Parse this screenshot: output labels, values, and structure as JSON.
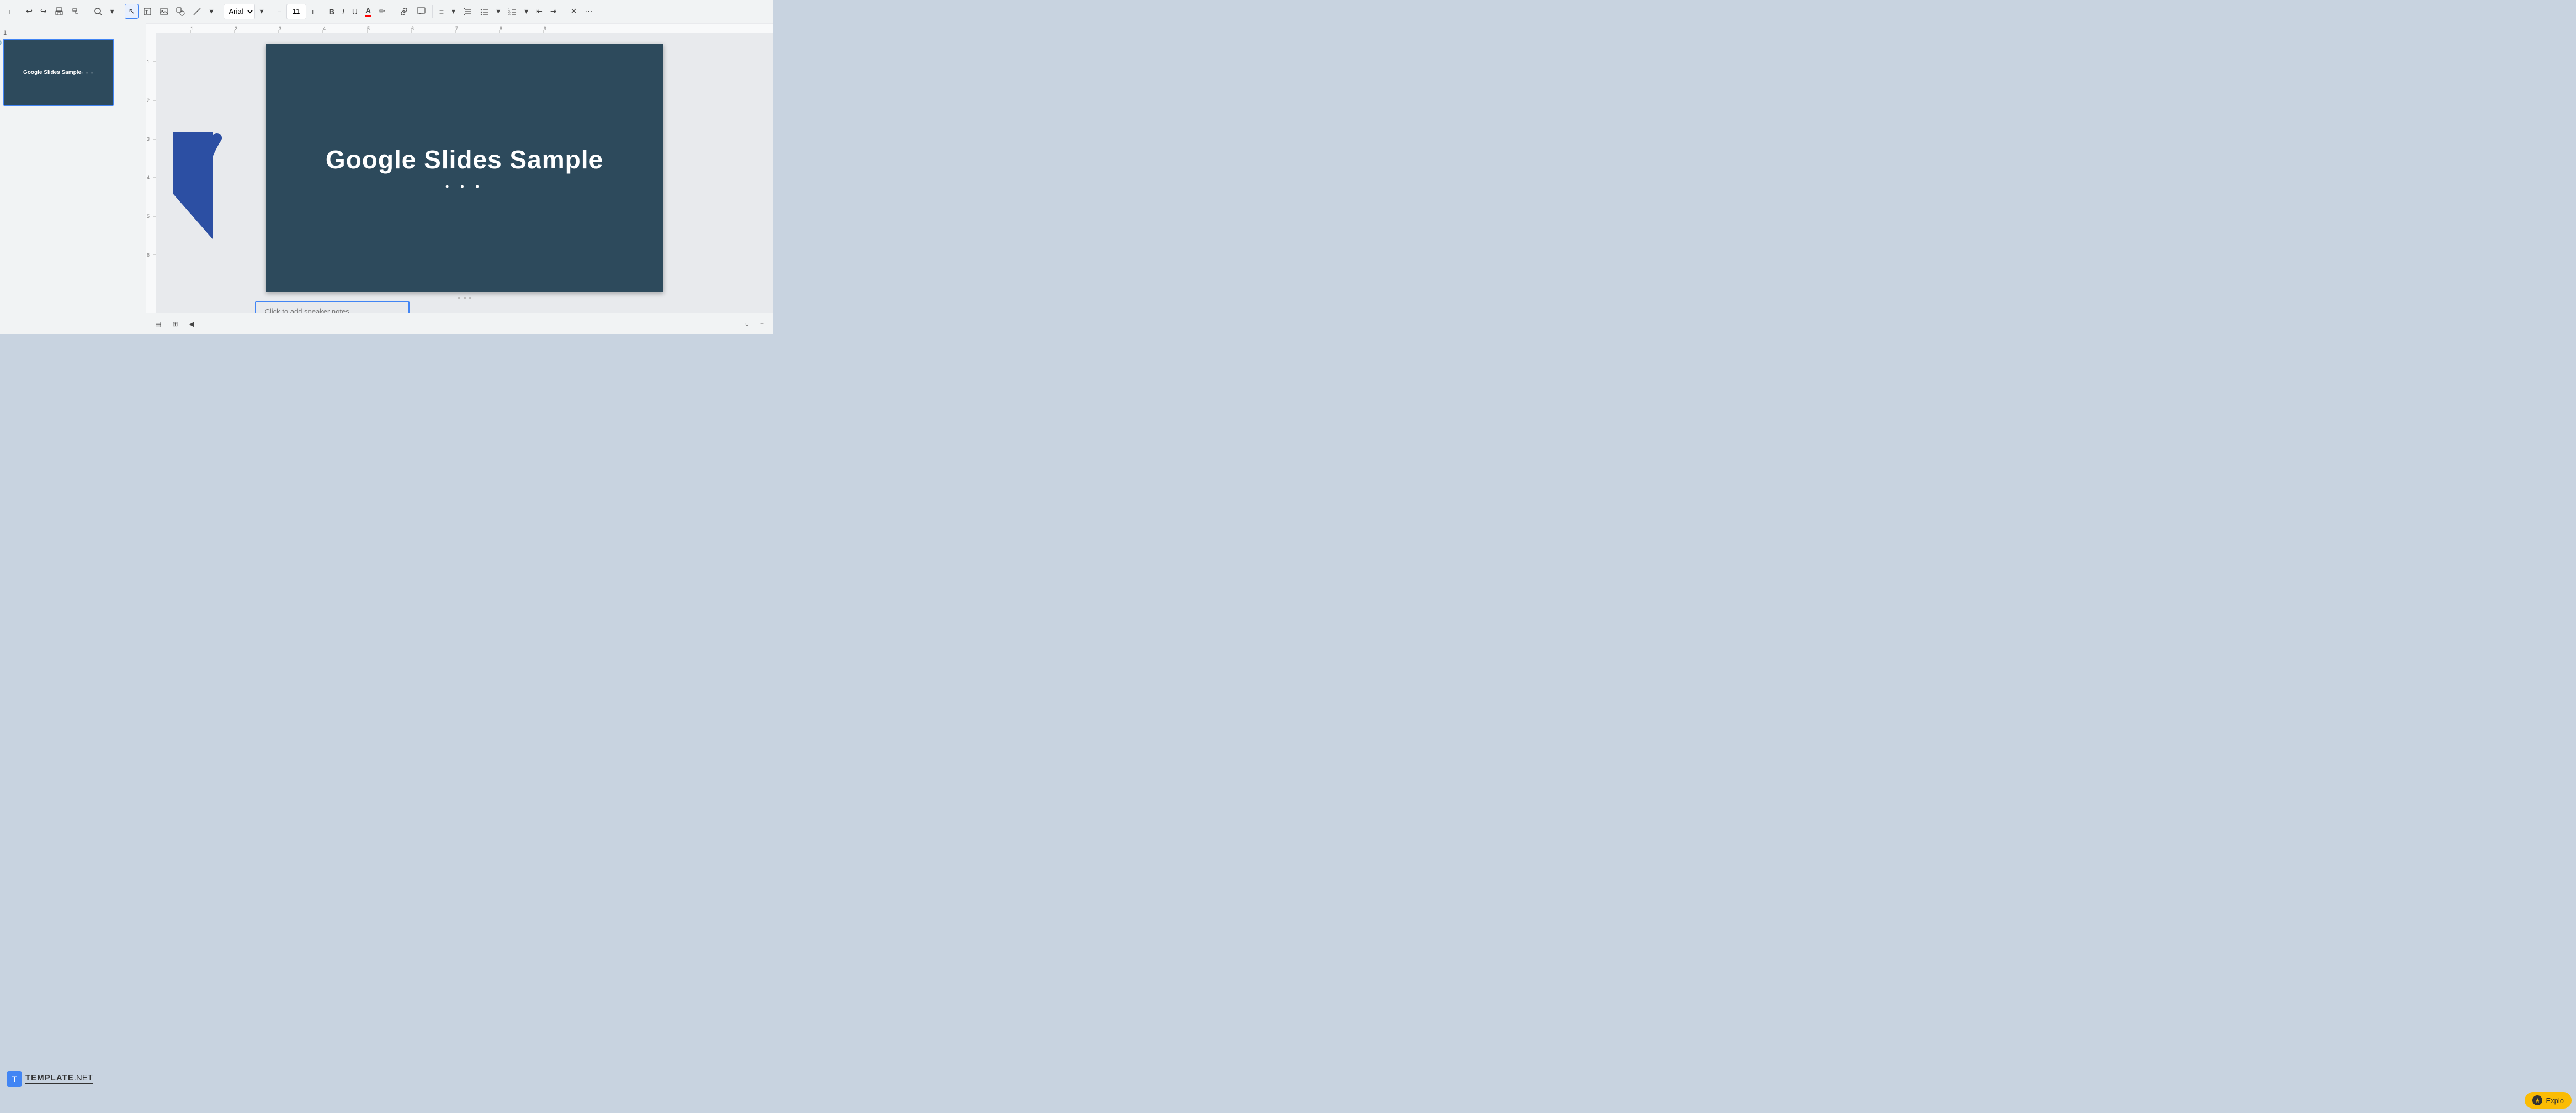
{
  "toolbar": {
    "add_label": "+",
    "undo_label": "↩",
    "redo_label": "↪",
    "print_label": "🖨",
    "format_label": "⬜",
    "zoom_label": "🔍",
    "zoom_dropdown": "▾",
    "cursor_label": "↖",
    "text_label": "T",
    "image_label": "🖼",
    "shape_label": "◻",
    "line_label": "/",
    "line_dropdown": "▾",
    "font_name": "Arial",
    "font_dropdown": "▾",
    "font_decrease": "−",
    "font_size": "11",
    "font_increase": "+",
    "bold_label": "B",
    "italic_label": "I",
    "underline_label": "U",
    "font_color_label": "A",
    "highlight_label": "✏",
    "link_label": "🔗",
    "comment_label": "💬",
    "align_label": "≡",
    "align_dropdown": "▾",
    "line_spacing_label": "≡",
    "bullets_label": "≡",
    "bullets_dropdown": "▾",
    "numbered_label": "≡",
    "numbered_dropdown": "▾",
    "indent_decrease_label": "⇤",
    "indent_increase_label": "⇥",
    "clear_label": "✕",
    "more_label": "⋯"
  },
  "slide_panel": {
    "slide_number": "1",
    "slide_title": "Google Slides Sample",
    "slide_dots": "• • •"
  },
  "canvas": {
    "slide_title": "Google Slides Sample",
    "slide_dots": "• • •"
  },
  "speaker_notes": {
    "placeholder": "Click to add speaker notes"
  },
  "bottom_bar": {
    "slide_view_label": "▤",
    "grid_view_label": "⊞",
    "collapse_label": "◀",
    "fit_label": "○",
    "zoom_in_label": "+"
  },
  "explore": {
    "icon": "★",
    "label": "Explo"
  },
  "logo": {
    "icon": "T",
    "brand": "TEMPLATE",
    "suffix": ".NET"
  },
  "ruler": {
    "marks": [
      "1",
      "2",
      "3",
      "4",
      "5",
      "6",
      "7",
      "8",
      "9"
    ],
    "vmarks": [
      "1",
      "2",
      "3",
      "4",
      "5",
      "6"
    ]
  }
}
